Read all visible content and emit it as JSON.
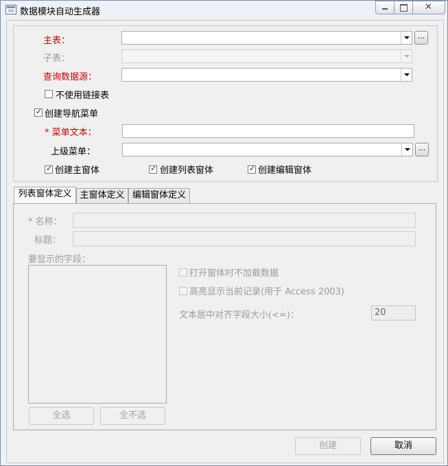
{
  "window": {
    "title": "数据模块自动生成器",
    "close_glyph": "✕"
  },
  "form": {
    "main_table_label": "主表：",
    "sub_table_label": "子表：",
    "query_source_label": "查询数据源：",
    "dots_label": "...",
    "no_link_table_label": "不使用链接表",
    "create_nav_menu_label": "创建导航菜单",
    "menu_text_label": "* 菜单文本：",
    "parent_menu_label": "上级菜单：",
    "create_main_form_label": "创建主窗体",
    "create_list_form_label": "创建列表窗体",
    "create_edit_form_label": "创建编辑窗体"
  },
  "tabs": [
    {
      "label": "列表窗体定义"
    },
    {
      "label": "主窗体定义"
    },
    {
      "label": "编辑窗体定义"
    }
  ],
  "list_tab": {
    "name_label": "* 名称：",
    "caption_label": "标题：",
    "fields_label": "要显示的字段：",
    "no_load_label": "打开窗体时不加载数据",
    "highlight_label": "高亮显示当前记录(用于 Access 2003)",
    "center_size_label": "文本居中对齐字段大小(<=)：",
    "center_size_value": "20",
    "select_all_label": "全选",
    "select_none_label": "全不选"
  },
  "footer": {
    "create_label": "创建",
    "cancel_label": "取消"
  },
  "colors": {
    "required_label": "#cc0000",
    "disabled_text": "#9a9a9a"
  }
}
